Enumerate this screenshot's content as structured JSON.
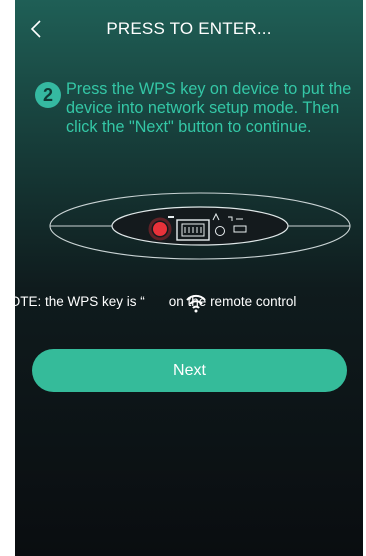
{
  "header": {
    "back_icon": "chevron-left-icon",
    "title": "PRESS TO ENTER..."
  },
  "step": {
    "number": "2",
    "text": "Press the WPS key on device to put the device into network setup mode. Then click the \"Next\" button to continue."
  },
  "note": {
    "before": "NOTE: the WPS key is “",
    "icon": "wifi-icon",
    "after": "on the remote control"
  },
  "next_button": {
    "label": "Next"
  },
  "colors": {
    "accent": "#35bb9a",
    "step_text": "#34c7a6",
    "led": "#e8323a"
  }
}
